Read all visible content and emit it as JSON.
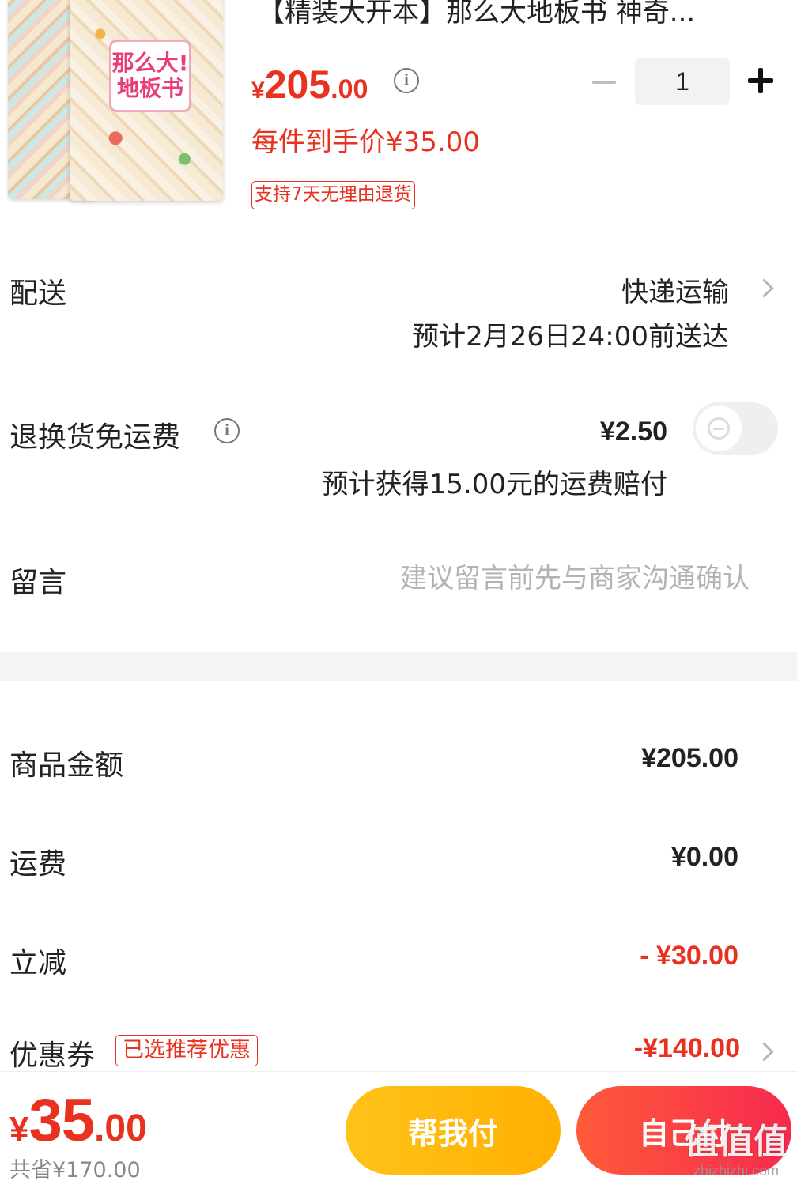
{
  "product": {
    "title": "【精装大开本】那么大地板书 神奇...",
    "cover_title_line1": "那么大!",
    "cover_title_line2": "地板书",
    "price_symbol": "¥",
    "price_int": "205",
    "price_dec": ".00",
    "quantity": "1",
    "final_price": "每件到手价¥35.00",
    "return_policy": "支持7天无理由退货"
  },
  "delivery": {
    "label": "配送",
    "method": "快递运输",
    "eta": "预计2月26日24:00前送达"
  },
  "return_shipping": {
    "label": "退换货免运费",
    "price": "¥2.50",
    "compensation": "预计获得15.00元的运费赔付",
    "enabled": false
  },
  "message": {
    "label": "留言",
    "placeholder": "建议留言前先与商家沟通确认",
    "value": ""
  },
  "summary": {
    "goods_label": "商品金额",
    "goods_amount": "¥205.00",
    "shipping_label": "运费",
    "shipping_amount": "¥0.00",
    "discount_label": "立减",
    "discount_amount": "- ¥30.00",
    "coupon_label": "优惠券",
    "coupon_tag": "已选推荐优惠",
    "coupon_amount": "-¥140.00"
  },
  "bottom": {
    "total_symbol": "¥",
    "total_int": "35",
    "total_dec": ".00",
    "saved": "共省¥170.00",
    "help_pay": "帮我付",
    "self_pay": "自己付"
  },
  "watermark": {
    "logo": "值值值",
    "site": "zhizhizhi.com"
  },
  "colors": {
    "accent_red": "#e8311f",
    "help_button": "#ffbb0e",
    "self_button": "#f83a47"
  }
}
